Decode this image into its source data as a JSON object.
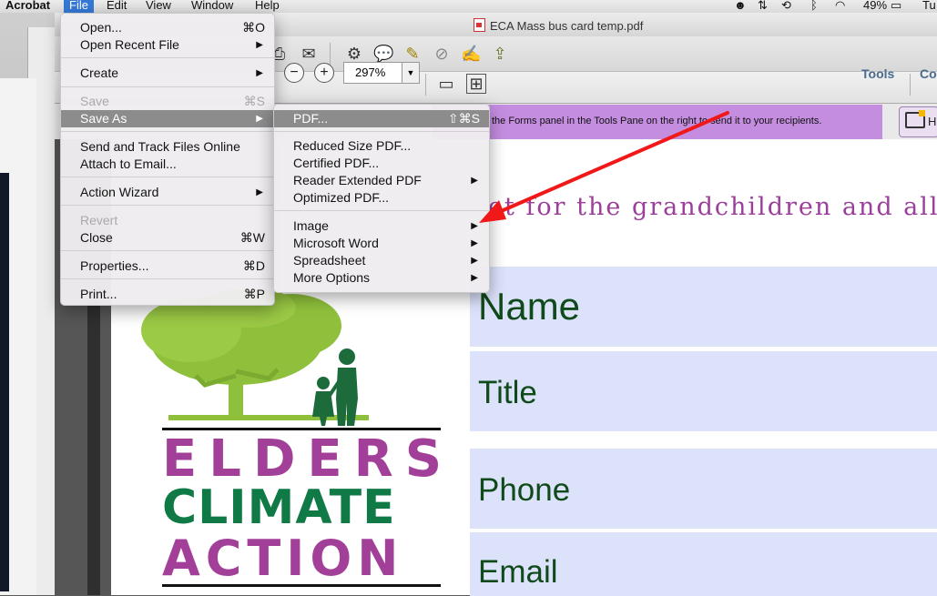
{
  "menubar": {
    "app": "Acrobat",
    "items": [
      "File",
      "Edit",
      "View",
      "Window",
      "Help"
    ],
    "active": "File",
    "status": {
      "battery": "49%",
      "clock_partial": "Tu"
    }
  },
  "window": {
    "title": "ECA Mass bus card temp.pdf"
  },
  "toolbar": {
    "zoom_value": "297%",
    "tools_label": "Tools",
    "comment_label_partial": "Co"
  },
  "forms_bar": {
    "message": "the Forms panel in the Tools Pane on the right to send it to your recipients.",
    "button_partial": "H"
  },
  "file_menu": {
    "items": [
      {
        "label": "Open...",
        "shortcut": "⌘O"
      },
      {
        "label": "Open Recent File",
        "submenu": true
      },
      {
        "label": "Create",
        "submenu": true
      },
      {
        "label": "Save",
        "shortcut": "⌘S",
        "disabled": true
      },
      {
        "label": "Save As",
        "submenu": true,
        "highlighted": true
      },
      {
        "label": "Send and Track Files Online"
      },
      {
        "label": "Attach to Email..."
      },
      {
        "label": "Action Wizard",
        "submenu": true
      },
      {
        "label": "Revert",
        "disabled": true
      },
      {
        "label": "Close",
        "shortcut": "⌘W"
      },
      {
        "label": "Properties...",
        "shortcut": "⌘D"
      },
      {
        "label": "Print...",
        "shortcut": "⌘P"
      }
    ]
  },
  "save_as_menu": {
    "items": [
      {
        "label": "PDF...",
        "shortcut": "⇧⌘S",
        "highlighted": true
      },
      {
        "label": "Reduced Size PDF..."
      },
      {
        "label": "Certified PDF..."
      },
      {
        "label": "Reader Extended PDF",
        "submenu": true
      },
      {
        "label": "Optimized PDF..."
      },
      {
        "label": "Image",
        "submenu": true
      },
      {
        "label": "Microsoft Word",
        "submenu": true
      },
      {
        "label": "Spreadsheet",
        "submenu": true
      },
      {
        "label": "More Options",
        "submenu": true
      }
    ]
  },
  "document": {
    "heading": "et for the grandchildren and all",
    "fields": [
      "Name",
      "Title",
      "Phone",
      "Email"
    ],
    "logo": {
      "line1": "ELDERS",
      "line2": "CLIMATE",
      "line3": "ACTION"
    }
  },
  "colors": {
    "heading": "#9b3f9a",
    "field_bg": "#dde2fb",
    "field_text": "#104a1a",
    "forms_bar": "#c58de0",
    "logo_purple": "#a23f98",
    "logo_green": "#0f7a45",
    "tree_green": "#8fc03c",
    "arrow": "#f01818"
  }
}
